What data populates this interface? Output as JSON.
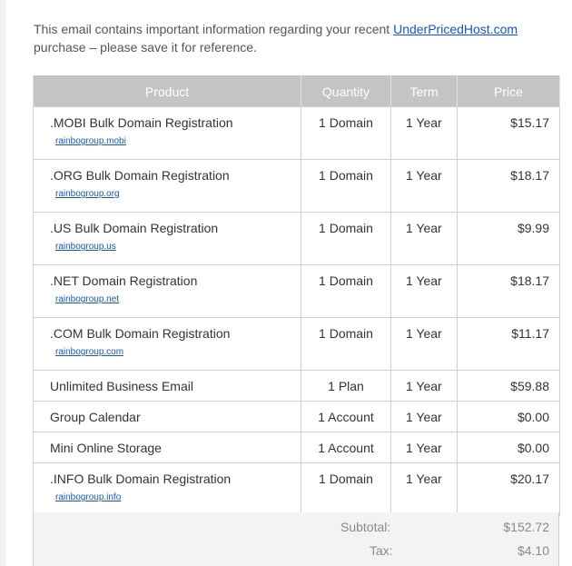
{
  "intro": {
    "text_before": "This email contains important information regarding your recent ",
    "link": "UnderPricedHost.com",
    "text_after": " purchase – please save it for reference."
  },
  "table": {
    "headers": {
      "product": "Product",
      "quantity": "Quantity",
      "term": "Term",
      "price": "Price"
    },
    "rows": [
      {
        "product": ".MOBI Bulk Domain Registration",
        "domain": "rainbogroup.mobi",
        "quantity": "1 Domain",
        "term": "1 Year",
        "price": "$15.17"
      },
      {
        "product": ".ORG Bulk Domain Registration",
        "domain": "rainbogroup.org",
        "quantity": "1 Domain",
        "term": "1 Year",
        "price": "$18.17"
      },
      {
        "product": ".US Bulk Domain Registration",
        "domain": "rainbogroup.us",
        "quantity": "1 Domain",
        "term": "1 Year",
        "price": "$9.99"
      },
      {
        "product": ".NET Domain Registration",
        "domain": "rainbogroup.net",
        "quantity": "1 Domain",
        "term": "1 Year",
        "price": "$18.17"
      },
      {
        "product": ".COM Bulk Domain Registration",
        "domain": "rainbogroup.com",
        "quantity": "1 Domain",
        "term": "1 Year",
        "price": "$11.17"
      },
      {
        "product": "Unlimited Business Email",
        "domain": "",
        "quantity": "1 Plan",
        "term": "1 Year",
        "price": "$59.88"
      },
      {
        "product": "Group Calendar",
        "domain": "",
        "quantity": "1 Account",
        "term": "1 Year",
        "price": "$0.00"
      },
      {
        "product": "Mini Online Storage",
        "domain": "",
        "quantity": "1 Account",
        "term": "1 Year",
        "price": "$0.00"
      },
      {
        "product": ".INFO Bulk Domain Registration",
        "domain": "rainbogroup.info",
        "quantity": "1 Domain",
        "term": "1 Year",
        "price": "$20.17"
      }
    ]
  },
  "summary": {
    "subtotal_label": "Subtotal:",
    "subtotal_value": "$152.72",
    "tax_label": "Tax:",
    "tax_value": "$4.10"
  },
  "colors": {
    "header_bg": "#c4c4c4",
    "link": "#1a55b8",
    "summary_bg": "#f3f3f3"
  }
}
